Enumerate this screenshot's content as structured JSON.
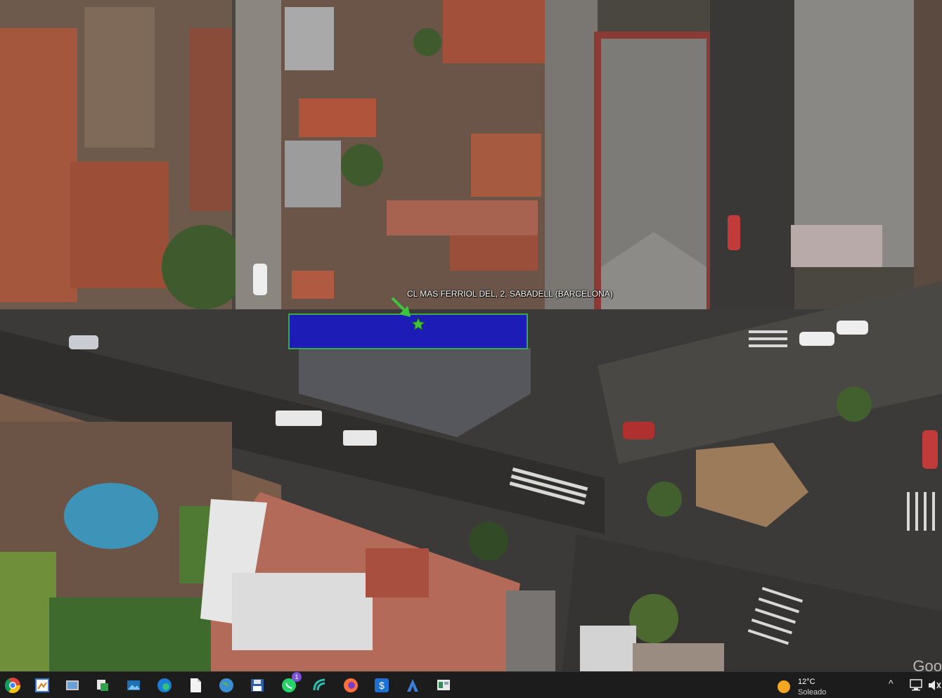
{
  "map": {
    "place_label": "CL MAS FERRIOL DEL, 2, SABADELL (BARCELONA)",
    "attribution": "Goo",
    "parcel_color": "#1a18c8",
    "marker_color": "#3ec43e"
  },
  "taskbar": {
    "apps": [
      {
        "name": "chrome-icon",
        "badge": ""
      },
      {
        "name": "paint-icon",
        "badge": ""
      },
      {
        "name": "photos-icon",
        "badge": ""
      },
      {
        "name": "file-transfer-icon",
        "badge": ""
      },
      {
        "name": "image-viewer-icon",
        "badge": ""
      },
      {
        "name": "edge-icon",
        "badge": ""
      },
      {
        "name": "document-icon",
        "badge": ""
      },
      {
        "name": "globe-icon",
        "badge": ""
      },
      {
        "name": "save-disk-icon",
        "badge": ""
      },
      {
        "name": "whatsapp-icon",
        "badge": "1"
      },
      {
        "name": "vpn-icon",
        "badge": ""
      },
      {
        "name": "firefox-icon",
        "badge": ""
      },
      {
        "name": "dollar-app-icon",
        "badge": ""
      },
      {
        "name": "autocad-icon",
        "badge": ""
      },
      {
        "name": "presentation-icon",
        "badge": ""
      }
    ],
    "weather": {
      "temperature": "12°C",
      "condition": "Soleado"
    },
    "tray": {
      "chevron": "^",
      "network": "network-icon",
      "volume": "volume-icon"
    }
  }
}
